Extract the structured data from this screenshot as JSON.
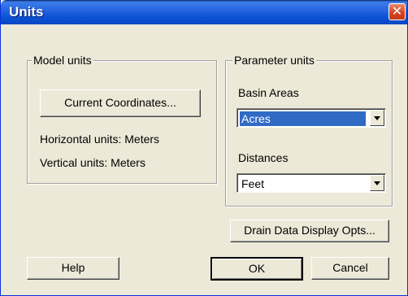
{
  "window": {
    "title": "Units",
    "close_glyph": "✕"
  },
  "model_units": {
    "legend": "Model units",
    "coordinates_button": "Current Coordinates...",
    "horizontal": "Horizontal units: Meters",
    "vertical": "Vertical units: Meters"
  },
  "parameter_units": {
    "legend": "Parameter units",
    "basin_label": "Basin Areas",
    "basin_value": "Acres",
    "distance_label": "Distances",
    "distance_value": "Feet"
  },
  "buttons": {
    "drain": "Drain Data Display Opts...",
    "help": "Help",
    "ok": "OK",
    "cancel": "Cancel"
  }
}
